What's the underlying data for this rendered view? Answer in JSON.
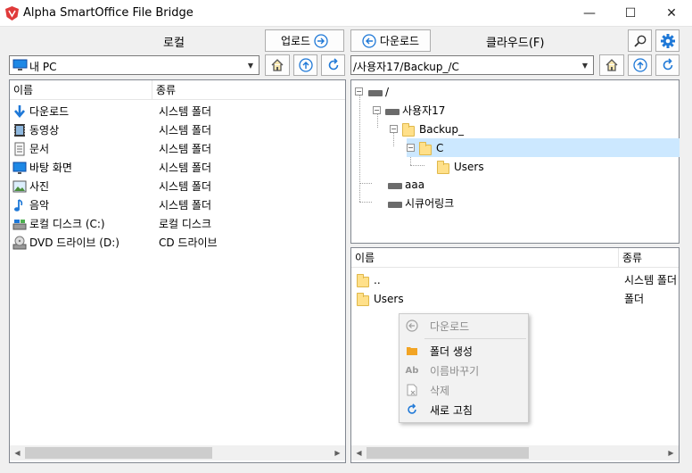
{
  "window": {
    "title": "Alpha SmartOffice File Bridge",
    "controls": {
      "minimize": "—",
      "maximize": "☐",
      "close": "✕"
    }
  },
  "local": {
    "heading": "로컬",
    "upload_label": "업로드",
    "path": "내 PC",
    "columns": {
      "name": "이름",
      "type": "종류"
    },
    "items": [
      {
        "icon": "download-arrow-icon",
        "name": "다운로드",
        "type": "시스템 폴더"
      },
      {
        "icon": "video-icon",
        "name": "동영상",
        "type": "시스템 폴더"
      },
      {
        "icon": "document-icon",
        "name": "문서",
        "type": "시스템 폴더"
      },
      {
        "icon": "desktop-icon",
        "name": "바탕 화면",
        "type": "시스템 폴더"
      },
      {
        "icon": "picture-icon",
        "name": "사진",
        "type": "시스템 폴더"
      },
      {
        "icon": "music-icon",
        "name": "음악",
        "type": "시스템 폴더"
      },
      {
        "icon": "local-disk-icon",
        "name": "로컬 디스크 (C:)",
        "type": "로컬 디스크"
      },
      {
        "icon": "dvd-drive-icon",
        "name": "DVD 드라이브 (D:)",
        "type": "CD 드라이브"
      }
    ]
  },
  "cloud": {
    "download_label": "다운로드",
    "heading": "클라우드(F)",
    "path": "/사용자17/Backup_/C",
    "tree": {
      "root": "/",
      "user": "사용자17",
      "backup": "Backup_",
      "c": "C",
      "users": "Users",
      "aaa": "aaa",
      "secure": "시큐어링크"
    },
    "columns": {
      "name": "이름",
      "type": "종류"
    },
    "files": [
      {
        "name": "..",
        "type": "시스템 폴더"
      },
      {
        "name": "Users",
        "type": "폴더"
      }
    ]
  },
  "context_menu": {
    "items": [
      {
        "icon": "download-icon",
        "label": "다운로드",
        "enabled": false
      },
      {
        "icon": "new-folder-icon",
        "label": "폴더 생성",
        "enabled": true
      },
      {
        "icon": "rename-icon",
        "label": "이름바꾸기",
        "enabled": false
      },
      {
        "icon": "delete-icon",
        "label": "삭제",
        "enabled": false
      },
      {
        "icon": "refresh-icon",
        "label": "새로 고침",
        "enabled": true
      }
    ]
  },
  "colors": {
    "accent": "#1e78d7",
    "selection": "#cce8ff",
    "folder": "#ffe08a"
  }
}
